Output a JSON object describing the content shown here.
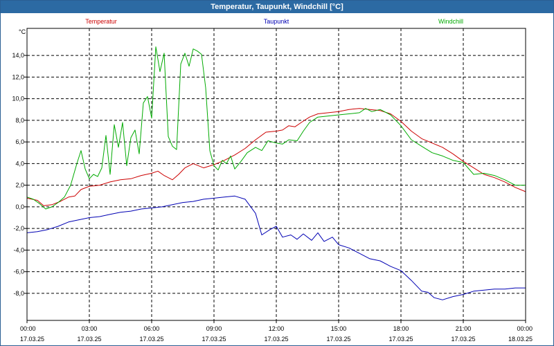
{
  "window": {
    "title": "Temperatur, Taupunkt, Windchill [°C]"
  },
  "chart_data": {
    "type": "line",
    "title": "Temperatur, Taupunkt, Windchill [°C]",
    "ylabel": "°C",
    "xlabel": "",
    "ylim": [
      -10.5,
      16.5
    ],
    "xlim": [
      0,
      24
    ],
    "grid": true,
    "legend_placement": "top",
    "yticks": [
      -8,
      -6,
      -4,
      -2,
      0,
      2,
      4,
      6,
      8,
      10,
      12,
      14
    ],
    "ytick_labels": [
      "-8,0",
      "-6,0",
      "-4,0",
      "-2,0",
      "0,0",
      "2,0",
      "4,0",
      "6,0",
      "8,0",
      "10,0",
      "12,0",
      "14,0"
    ],
    "x_ticks": [
      {
        "x": 0,
        "time": "00:00",
        "date": "17.03.25"
      },
      {
        "x": 3,
        "time": "03:00",
        "date": "17.03.25"
      },
      {
        "x": 6,
        "time": "06:00",
        "date": "17.03.25"
      },
      {
        "x": 9,
        "time": "09:00",
        "date": "17.03.25"
      },
      {
        "x": 12,
        "time": "12:00",
        "date": "17.03.25"
      },
      {
        "x": 15,
        "time": "15:00",
        "date": "17.03.25"
      },
      {
        "x": 18,
        "time": "18:00",
        "date": "17.03.25"
      },
      {
        "x": 21,
        "time": "21:00",
        "date": "17.03.25"
      },
      {
        "x": 24,
        "time": "00:00",
        "date": "18.03.25"
      }
    ],
    "series": [
      {
        "name": "Temperatur",
        "color": "#cc0000",
        "points": [
          [
            0,
            0.8
          ],
          [
            0.5,
            0.6
          ],
          [
            0.8,
            0.1
          ],
          [
            1.2,
            0.2
          ],
          [
            1.6,
            0.5
          ],
          [
            2.0,
            0.9
          ],
          [
            2.3,
            1.0
          ],
          [
            2.6,
            1.6
          ],
          [
            3.0,
            1.9
          ],
          [
            3.5,
            2.0
          ],
          [
            4.0,
            2.3
          ],
          [
            4.5,
            2.5
          ],
          [
            5.0,
            2.6
          ],
          [
            5.5,
            2.9
          ],
          [
            6.0,
            3.1
          ],
          [
            6.3,
            3.3
          ],
          [
            6.6,
            2.9
          ],
          [
            7.0,
            2.5
          ],
          [
            7.3,
            3.0
          ],
          [
            7.6,
            3.6
          ],
          [
            8.0,
            4.0
          ],
          [
            8.5,
            3.6
          ],
          [
            9.0,
            3.9
          ],
          [
            9.5,
            4.3
          ],
          [
            10.0,
            4.8
          ],
          [
            10.5,
            5.4
          ],
          [
            11.0,
            6.2
          ],
          [
            11.5,
            6.9
          ],
          [
            12.0,
            7.0
          ],
          [
            12.3,
            7.1
          ],
          [
            12.6,
            7.5
          ],
          [
            12.9,
            7.4
          ],
          [
            13.2,
            7.8
          ],
          [
            13.6,
            8.3
          ],
          [
            14.0,
            8.6
          ],
          [
            14.5,
            8.7
          ],
          [
            15.0,
            8.8
          ],
          [
            15.5,
            9.0
          ],
          [
            16.0,
            9.1
          ],
          [
            16.5,
            9.0
          ],
          [
            17.0,
            8.9
          ],
          [
            17.5,
            8.6
          ],
          [
            18.0,
            7.9
          ],
          [
            18.5,
            7.0
          ],
          [
            19.0,
            6.3
          ],
          [
            19.5,
            5.9
          ],
          [
            20.0,
            5.5
          ],
          [
            20.5,
            4.9
          ],
          [
            21.0,
            4.2
          ],
          [
            21.5,
            3.6
          ],
          [
            22.0,
            3.0
          ],
          [
            22.5,
            2.7
          ],
          [
            23.0,
            2.3
          ],
          [
            23.5,
            1.8
          ],
          [
            24.0,
            1.4
          ]
        ]
      },
      {
        "name": "Taupunkt",
        "color": "#0000b3",
        "points": [
          [
            0,
            -2.4
          ],
          [
            0.5,
            -2.3
          ],
          [
            1.0,
            -2.1
          ],
          [
            1.5,
            -1.8
          ],
          [
            2.0,
            -1.4
          ],
          [
            2.5,
            -1.2
          ],
          [
            3.0,
            -1.0
          ],
          [
            3.5,
            -0.9
          ],
          [
            4.0,
            -0.7
          ],
          [
            4.5,
            -0.5
          ],
          [
            5.0,
            -0.4
          ],
          [
            5.5,
            -0.2
          ],
          [
            6.0,
            -0.1
          ],
          [
            6.5,
            0.0
          ],
          [
            7.0,
            0.2
          ],
          [
            7.5,
            0.4
          ],
          [
            8.0,
            0.5
          ],
          [
            8.5,
            0.7
          ],
          [
            9.0,
            0.8
          ],
          [
            9.5,
            0.9
          ],
          [
            10.0,
            1.0
          ],
          [
            10.5,
            0.7
          ],
          [
            11.0,
            -0.6
          ],
          [
            11.3,
            -2.6
          ],
          [
            11.7,
            -2.1
          ],
          [
            12.0,
            -1.8
          ],
          [
            12.3,
            -2.8
          ],
          [
            12.7,
            -2.6
          ],
          [
            13.0,
            -3.0
          ],
          [
            13.3,
            -2.5
          ],
          [
            13.7,
            -3.1
          ],
          [
            14.0,
            -2.4
          ],
          [
            14.3,
            -3.2
          ],
          [
            14.7,
            -2.8
          ],
          [
            15.0,
            -3.5
          ],
          [
            15.5,
            -3.8
          ],
          [
            16.0,
            -4.3
          ],
          [
            16.5,
            -4.8
          ],
          [
            17.0,
            -5.0
          ],
          [
            17.5,
            -5.5
          ],
          [
            18.0,
            -5.9
          ],
          [
            18.5,
            -6.8
          ],
          [
            19.0,
            -7.8
          ],
          [
            19.3,
            -7.9
          ],
          [
            19.6,
            -8.4
          ],
          [
            20.0,
            -8.6
          ],
          [
            20.5,
            -8.3
          ],
          [
            21.0,
            -8.1
          ],
          [
            21.5,
            -7.8
          ],
          [
            22.0,
            -7.7
          ],
          [
            22.5,
            -7.6
          ],
          [
            23.0,
            -7.6
          ],
          [
            23.5,
            -7.5
          ],
          [
            24.0,
            -7.5
          ]
        ]
      },
      {
        "name": "Windchill",
        "color": "#00aa00",
        "points": [
          [
            0,
            0.9
          ],
          [
            0.3,
            0.7
          ],
          [
            0.6,
            0.3
          ],
          [
            0.9,
            -0.2
          ],
          [
            1.2,
            0.0
          ],
          [
            1.5,
            0.4
          ],
          [
            1.8,
            0.9
          ],
          [
            2.1,
            2.0
          ],
          [
            2.4,
            4.0
          ],
          [
            2.6,
            5.2
          ],
          [
            2.8,
            3.5
          ],
          [
            3.0,
            2.6
          ],
          [
            3.2,
            3.0
          ],
          [
            3.4,
            2.8
          ],
          [
            3.6,
            3.6
          ],
          [
            3.8,
            6.6
          ],
          [
            4.0,
            3.0
          ],
          [
            4.2,
            7.6
          ],
          [
            4.4,
            5.5
          ],
          [
            4.6,
            7.8
          ],
          [
            4.8,
            3.8
          ],
          [
            5.0,
            6.4
          ],
          [
            5.2,
            7.1
          ],
          [
            5.4,
            4.9
          ],
          [
            5.6,
            9.6
          ],
          [
            5.8,
            10.2
          ],
          [
            6.0,
            8.2
          ],
          [
            6.2,
            14.8
          ],
          [
            6.4,
            12.5
          ],
          [
            6.6,
            14.2
          ],
          [
            6.8,
            6.5
          ],
          [
            7.0,
            5.6
          ],
          [
            7.2,
            5.3
          ],
          [
            7.4,
            13.2
          ],
          [
            7.6,
            14.2
          ],
          [
            7.8,
            13.0
          ],
          [
            8.0,
            14.6
          ],
          [
            8.2,
            14.4
          ],
          [
            8.4,
            14.1
          ],
          [
            8.6,
            11.0
          ],
          [
            8.8,
            5.2
          ],
          [
            9.0,
            3.8
          ],
          [
            9.2,
            3.4
          ],
          [
            9.4,
            4.3
          ],
          [
            9.6,
            4.0
          ],
          [
            9.8,
            4.7
          ],
          [
            10.0,
            3.5
          ],
          [
            10.3,
            4.2
          ],
          [
            10.6,
            5.0
          ],
          [
            11.0,
            5.5
          ],
          [
            11.3,
            5.2
          ],
          [
            11.6,
            6.1
          ],
          [
            12.0,
            5.9
          ],
          [
            12.3,
            5.8
          ],
          [
            12.6,
            6.2
          ],
          [
            13.0,
            6.1
          ],
          [
            13.3,
            7.0
          ],
          [
            13.6,
            7.8
          ],
          [
            14.0,
            8.3
          ],
          [
            14.5,
            8.4
          ],
          [
            15.0,
            8.5
          ],
          [
            15.5,
            8.6
          ],
          [
            16.0,
            8.7
          ],
          [
            16.3,
            9.1
          ],
          [
            16.6,
            8.8
          ],
          [
            17.0,
            9.0
          ],
          [
            17.5,
            8.5
          ],
          [
            18.0,
            7.5
          ],
          [
            18.5,
            6.2
          ],
          [
            19.0,
            5.6
          ],
          [
            19.5,
            5.0
          ],
          [
            20.0,
            4.7
          ],
          [
            20.5,
            4.3
          ],
          [
            21.0,
            4.1
          ],
          [
            21.5,
            3.0
          ],
          [
            22.0,
            3.1
          ],
          [
            22.5,
            2.9
          ],
          [
            23.0,
            2.5
          ],
          [
            23.5,
            2.0
          ],
          [
            24.0,
            2.0
          ]
        ]
      }
    ]
  }
}
